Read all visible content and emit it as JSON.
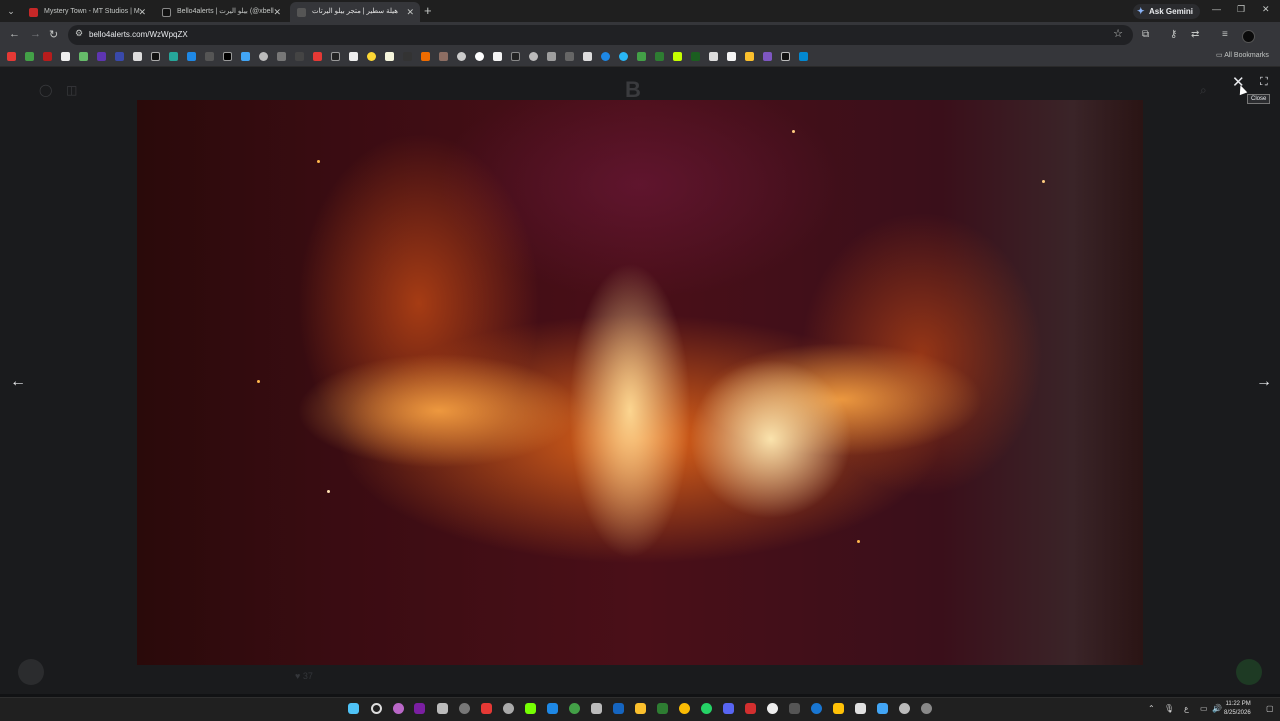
{
  "browser": {
    "tabs": [
      {
        "title": "Mystery Town - MT Studios | M",
        "active": false
      },
      {
        "title": "Bello4alerts | بيلو اليرت (@xbell",
        "active": false
      },
      {
        "title": "هيلة سطير | متجر بيلو اليرتات",
        "active": true
      }
    ],
    "gemini_label": "Ask Gemini",
    "url": "bello4alerts.com/WzWpqZX",
    "all_bookmarks_label": "All Bookmarks"
  },
  "viewer": {
    "close_tooltip": "Close",
    "bottom_count": "37"
  },
  "taskbar": {
    "lang": "ع",
    "time": "11:22 PM",
    "date": "8/25/2026"
  },
  "colors": {
    "tab_strip": "#1f1f1f",
    "toolbar": "#35363a",
    "viewer_bg": "#1a1b1d",
    "taskbar": "#202020"
  }
}
